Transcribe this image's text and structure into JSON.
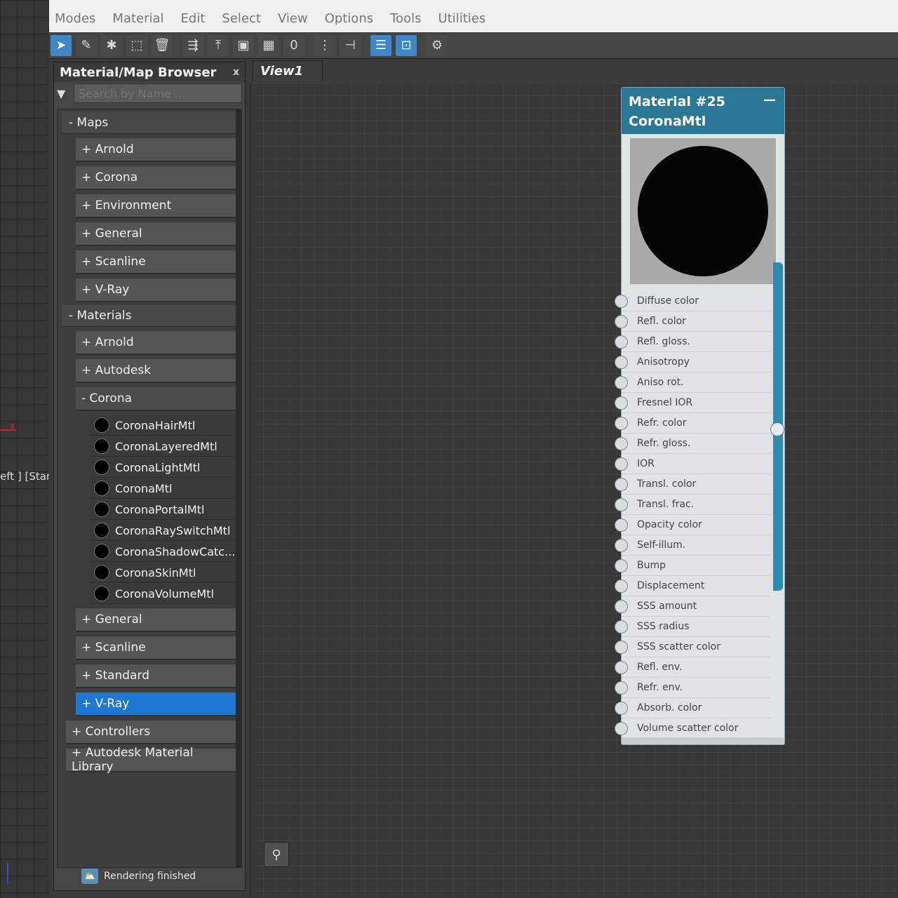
{
  "menu": [
    "Modes",
    "Material",
    "Edit",
    "Select",
    "View",
    "Options",
    "Tools",
    "Utilities"
  ],
  "viewport": {
    "label": "eft ] [Standa",
    "axis_label": "x"
  },
  "toolbar": {
    "tools": [
      {
        "icon": "select-arrow-icon",
        "glyph": "➤",
        "active": true
      },
      {
        "icon": "eyedropper-icon",
        "glyph": "✎",
        "active": false
      },
      {
        "icon": "pick-material-icon",
        "glyph": "✱",
        "active": false
      },
      {
        "icon": "assign-material-icon",
        "glyph": "⬚",
        "active": false
      },
      {
        "icon": "delete-icon",
        "glyph": "🗑",
        "active": false
      },
      {
        "icon": "layout-tree-icon",
        "glyph": "⇶",
        "active": false
      },
      {
        "icon": "move-children-icon",
        "glyph": "⤒",
        "active": false
      },
      {
        "icon": "show-map-icon",
        "glyph": "▣",
        "active": false
      },
      {
        "icon": "checker-background-icon",
        "glyph": "▦",
        "active": false
      },
      {
        "icon": "material-id-icon",
        "glyph": "0",
        "active": false
      },
      {
        "icon": "layout-vertical-icon",
        "glyph": "⋮",
        "active": false
      },
      {
        "icon": "layout-horizontal-icon",
        "glyph": "⊣",
        "active": false
      },
      {
        "icon": "parameter-editor-icon",
        "glyph": "☰",
        "active": true
      },
      {
        "icon": "browser-icon",
        "glyph": "⊡",
        "active": true
      },
      {
        "icon": "select-by-material-icon",
        "glyph": "⚙",
        "active": false
      }
    ]
  },
  "browser": {
    "title": "Material/Map Browser",
    "close_label": "x",
    "search_placeholder": "Search by Name ...",
    "groups": [
      {
        "label": "- Maps",
        "items": [
          {
            "label": "+ Arnold"
          },
          {
            "label": "+ Corona"
          },
          {
            "label": "+ Environment"
          },
          {
            "label": "+ General"
          },
          {
            "label": "+ Scanline"
          },
          {
            "label": "+ V-Ray"
          }
        ]
      },
      {
        "label": "- Materials",
        "items": [
          {
            "label": "+ Arnold"
          },
          {
            "label": "+ Autodesk"
          },
          {
            "label": "- Corona",
            "expanded": true,
            "children": [
              "CoronaHairMtl",
              "CoronaLayeredMtl",
              "CoronaLightMtl",
              "CoronaMtl",
              "CoronaPortalMtl",
              "CoronaRaySwitchMtl",
              "CoronaShadowCatc...",
              "CoronaSkinMtl",
              "CoronaVolumeMtl"
            ]
          },
          {
            "label": "+ General"
          },
          {
            "label": "+ Scanline"
          },
          {
            "label": "+ Standard"
          },
          {
            "label": "+ V-Ray",
            "selected": true
          }
        ]
      }
    ],
    "bottom_groups": [
      "+ Controllers",
      "+ Autodesk Material Library"
    ]
  },
  "view": {
    "tab_label": "View1"
  },
  "node": {
    "title_line1": "Material #25",
    "title_line2": "CoronaMtl",
    "minimize_label": "—",
    "slots": [
      "Diffuse color",
      "Refl. color",
      "Refl. gloss.",
      "Anisotropy",
      "Aniso rot.",
      "Fresnel IOR",
      "Refr. color",
      "Refr. gloss.",
      "IOR",
      "Transl. color",
      "Transl. frac.",
      "Opacity color",
      "Self-illum.",
      "Bump",
      "Displacement",
      "SSS amount",
      "SSS radius",
      "SSS scatter color",
      "Refl. env.",
      "Refr. env.",
      "Absorb. color",
      "Volume scatter color"
    ]
  },
  "status": {
    "text": "Rendering finished"
  },
  "colors": {
    "accent": "#1e78d2",
    "node_header": "#2a7896",
    "node_bar": "#2a8ab2"
  }
}
